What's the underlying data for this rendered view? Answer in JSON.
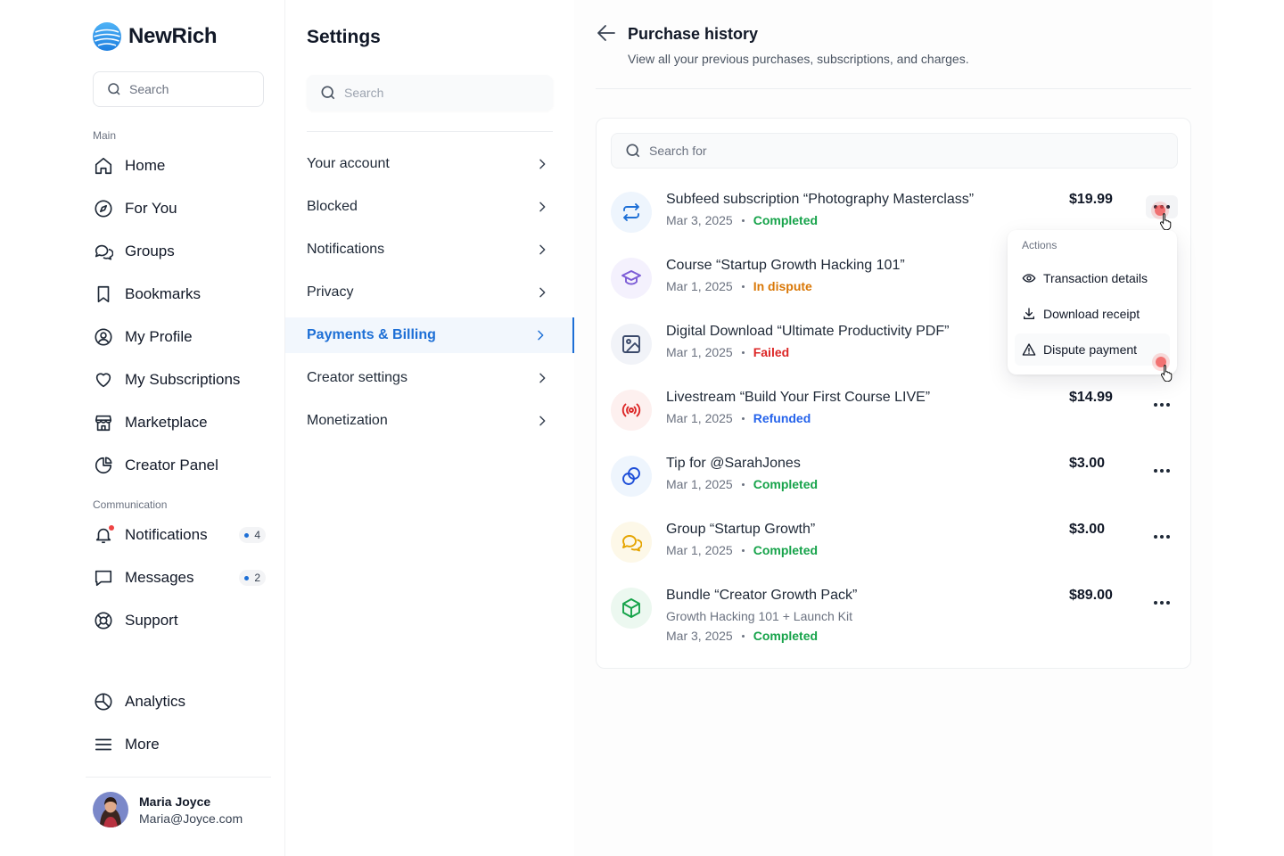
{
  "brand": {
    "name": "NewRich"
  },
  "sidebar": {
    "search_placeholder": "Search",
    "section_main": "Main",
    "section_communication": "Communication",
    "main_items": [
      {
        "label": "Home",
        "icon": "home-icon"
      },
      {
        "label": "For You",
        "icon": "compass-icon"
      },
      {
        "label": "Groups",
        "icon": "chat-bubbles-icon"
      },
      {
        "label": "Bookmarks",
        "icon": "bookmark-icon"
      },
      {
        "label": "My Profile",
        "icon": "user-circle-icon"
      },
      {
        "label": "My Subscriptions",
        "icon": "heart-icon"
      },
      {
        "label": "Marketplace",
        "icon": "store-icon"
      },
      {
        "label": "Creator Panel",
        "icon": "pie-chart-icon"
      }
    ],
    "communication_items": [
      {
        "label": "Notifications",
        "icon": "bell-icon",
        "badge": "4"
      },
      {
        "label": "Messages",
        "icon": "message-icon",
        "badge": "2"
      },
      {
        "label": "Support",
        "icon": "lifebuoy-icon"
      }
    ],
    "bottom_items": [
      {
        "label": "Analytics",
        "icon": "analytics-icon"
      },
      {
        "label": "More",
        "icon": "menu-icon"
      }
    ],
    "user": {
      "name": "Maria Joyce",
      "email": "Maria@Joyce.com"
    }
  },
  "settings": {
    "title": "Settings",
    "search_placeholder": "Search",
    "items": [
      {
        "label": "Your account"
      },
      {
        "label": "Blocked"
      },
      {
        "label": "Notifications"
      },
      {
        "label": "Privacy"
      },
      {
        "label": "Payments & Billing",
        "active": true
      },
      {
        "label": "Creator settings"
      },
      {
        "label": "Monetization"
      }
    ]
  },
  "purchase_history": {
    "title": "Purchase history",
    "subtitle": "View all your previous purchases, subscriptions, and charges.",
    "search_placeholder": "Search for",
    "rows": [
      {
        "title": "Subfeed subscription “Photography Masterclass”",
        "date": "Mar 3, 2025",
        "status": "Completed",
        "amount": "$19.99"
      },
      {
        "title": "Course “Startup Growth Hacking 101”",
        "date": "Mar 1, 2025",
        "status": "In dispute",
        "amount": ""
      },
      {
        "title": "Digital Download “Ultimate Productivity PDF”",
        "date": "Mar 1, 2025",
        "status": "Failed",
        "amount": ""
      },
      {
        "title": "Livestream “Build Your First Course LIVE”",
        "date": "Mar 1, 2025",
        "status": "Refunded",
        "amount": "$14.99"
      },
      {
        "title": "Tip for @SarahJones",
        "date": "Mar 1, 2025",
        "status": "Completed",
        "amount": "$3.00"
      },
      {
        "title": "Group “Startup Growth”",
        "date": "Mar 1, 2025",
        "status": "Completed",
        "amount": "$3.00"
      },
      {
        "title": "Bundle “Creator Growth Pack”",
        "subtitle": "Growth Hacking 101 + Launch Kit",
        "date": "Mar 3, 2025",
        "status": "Completed",
        "amount": "$89.00"
      }
    ],
    "actions_menu": {
      "heading": "Actions",
      "items": [
        {
          "label": "Transaction details",
          "icon": "eye-icon"
        },
        {
          "label": "Download receipt",
          "icon": "download-icon"
        },
        {
          "label": "Dispute payment",
          "icon": "warning-icon"
        }
      ]
    }
  },
  "colors": {
    "accent": "#1d6fd6",
    "completed": "#16a34a",
    "in_dispute": "#d97706",
    "failed": "#dc2626",
    "refunded": "#2563eb"
  }
}
